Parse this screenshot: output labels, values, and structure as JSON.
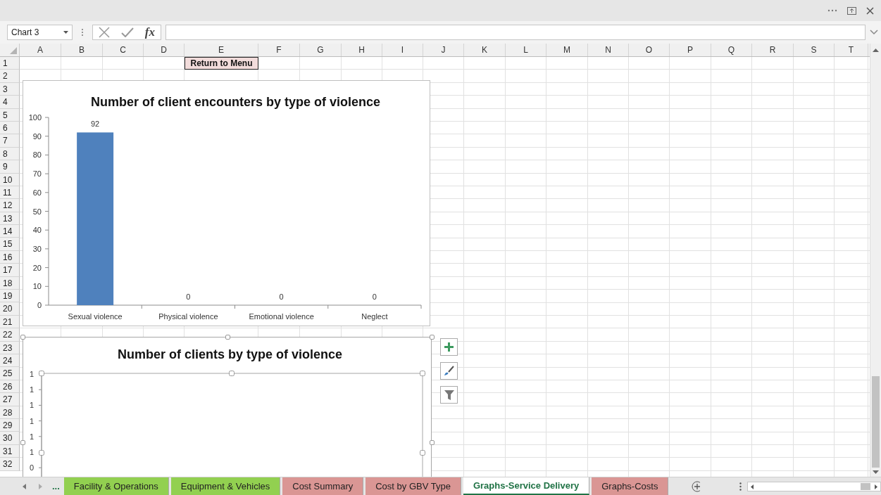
{
  "name_box": {
    "value": "Chart 3"
  },
  "formula_label": "fx",
  "columns": [
    "A",
    "B",
    "C",
    "D",
    "E",
    "F",
    "G",
    "H",
    "I",
    "J",
    "K",
    "L",
    "M",
    "N",
    "O",
    "P",
    "Q",
    "R",
    "S",
    "T"
  ],
  "rows": [
    "1",
    "2",
    "3",
    "4",
    "5",
    "6",
    "7",
    "8",
    "9",
    "10",
    "11",
    "12",
    "13",
    "14",
    "15",
    "16",
    "17",
    "18",
    "19",
    "20",
    "21",
    "22",
    "23",
    "24",
    "25",
    "26",
    "27",
    "28",
    "29",
    "30",
    "31",
    "32"
  ],
  "return_button": {
    "label": "Return to Menu"
  },
  "charts": [
    {
      "title": "Number of client encounters by type of violence",
      "selected": false,
      "chart_data": {
        "type": "bar",
        "categories": [
          "Sexual violence",
          "Physical violence",
          "Emotional violence",
          "Neglect"
        ],
        "values": [
          92,
          0,
          0,
          0
        ],
        "ylim": [
          0,
          100
        ],
        "yticks": [
          0,
          10,
          20,
          30,
          40,
          50,
          60,
          70,
          80,
          90,
          100
        ],
        "data_labels": true
      }
    },
    {
      "title": "Number of clients by type of violence",
      "selected": true,
      "y_axis_labels": [
        "1",
        "1",
        "1",
        "1",
        "1",
        "1",
        "0"
      ]
    }
  ],
  "more_tabs": "...",
  "sheet_tabs": [
    {
      "label": "Facility & Operations",
      "color": "#92d050",
      "selected": false
    },
    {
      "label": "Equipment & Vehicles",
      "color": "#92d050",
      "selected": false
    },
    {
      "label": "Cost Summary",
      "color": "#da9694",
      "selected": false
    },
    {
      "label": "Cost by GBV Type",
      "color": "#da9694",
      "selected": false
    },
    {
      "label": "Graphs-Service Delivery",
      "selected": true
    },
    {
      "label": "Graphs-Costs",
      "color": "#da9694",
      "selected": false
    }
  ]
}
